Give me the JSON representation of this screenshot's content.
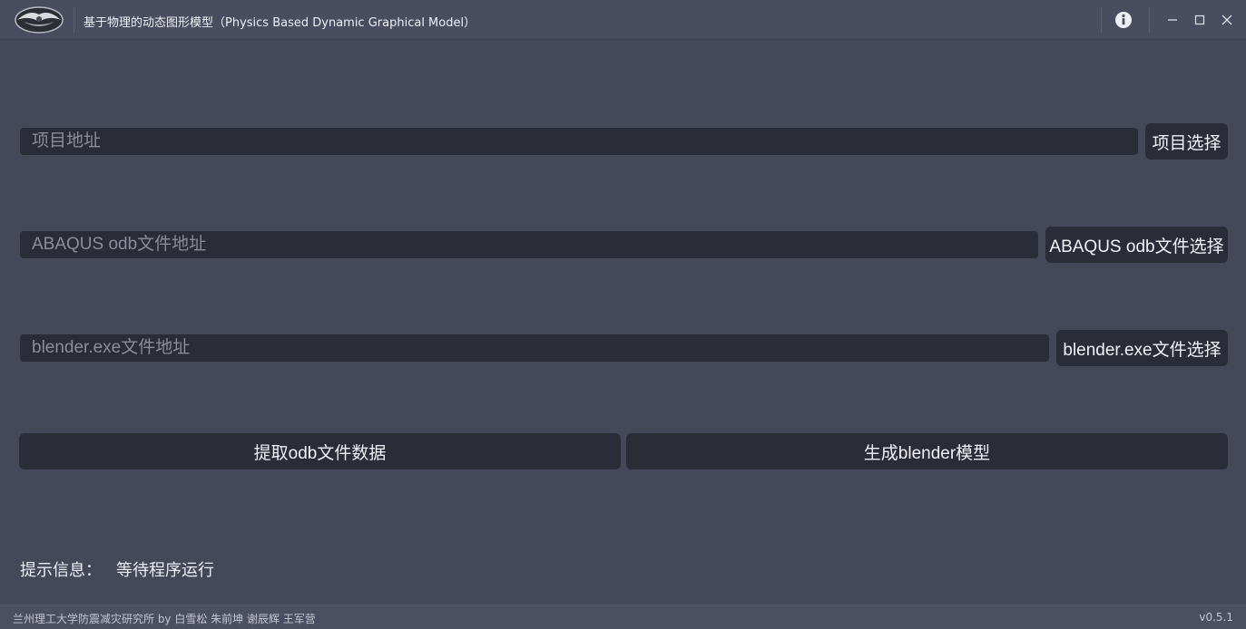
{
  "window": {
    "title": "基于物理的动态图形模型（Physics Based Dynamic Graphical Model）",
    "logo_icon": "winged-emblem-logo",
    "info_icon": "info-icon",
    "minimize_icon": "minimize-icon",
    "maximize_icon": "maximize-icon",
    "close_icon": "close-icon"
  },
  "project": {
    "placeholder": "项目地址",
    "value": "",
    "button_label": "项目选择"
  },
  "odb": {
    "placeholder": "ABAQUS odb文件地址",
    "value": "",
    "button_label": "ABAQUS odb文件选择"
  },
  "blender": {
    "placeholder": "blender.exe文件地址",
    "value": "",
    "button_label": "blender.exe文件选择"
  },
  "actions": {
    "extract_label": "提取odb文件数据",
    "generate_label": "生成blender模型"
  },
  "status": {
    "label": "提示信息：",
    "value": "等待程序运行"
  },
  "footer": {
    "credits": "兰州理工大学防震减灾研究所 by 白雪松 朱前坤 谢辰辉 王军营",
    "version": "v0.5.1"
  },
  "colors": {
    "background": "#454858",
    "titlebar": "#4a4d60",
    "field": "#2a2c37",
    "text": "#e8e9ef",
    "placeholder": "#8a8d9a"
  }
}
